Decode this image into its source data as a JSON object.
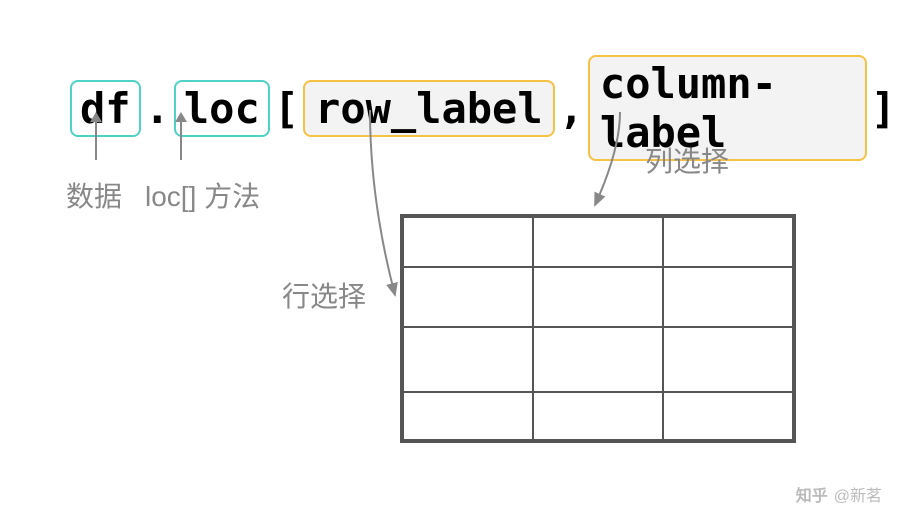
{
  "code": {
    "df": "df",
    "dot": ".",
    "loc": "loc",
    "open_bracket": "[",
    "row_label": "row_label",
    "comma": ",",
    "column_label": "column-label",
    "close_bracket": "]"
  },
  "labels": {
    "data": "数据",
    "loc_method": "loc[] 方法",
    "row_select": "行选择",
    "col_select": "列选择"
  },
  "watermark": {
    "site": "知乎",
    "author": "@新茗"
  }
}
